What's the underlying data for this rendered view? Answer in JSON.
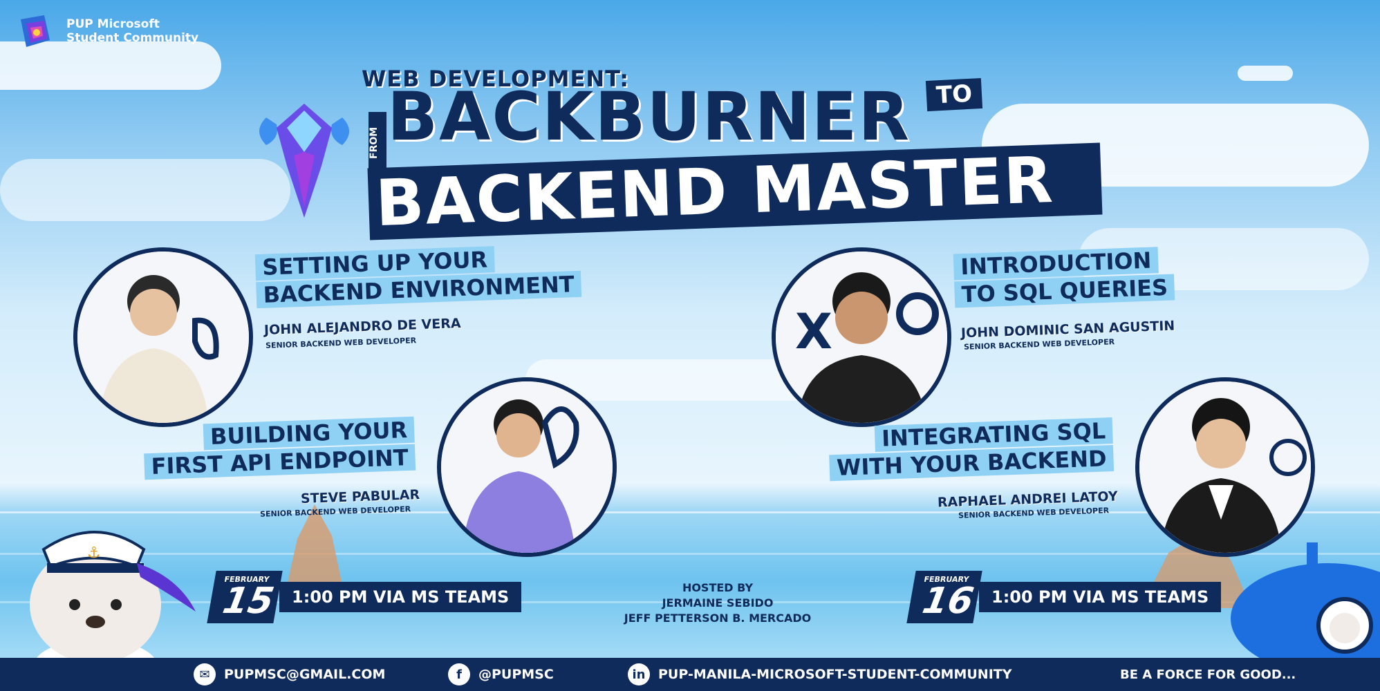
{
  "brand": {
    "name": "PUP Microsoft Student Community",
    "logo_icon": "pupmsc-logo-icon"
  },
  "title": {
    "kicker": "WEB DEVELOPMENT:",
    "from": "FROM",
    "line1": "BACKBURNER",
    "to": "TO",
    "line2": "BACKEND MASTER"
  },
  "sessions": [
    {
      "topic": [
        "SETTING UP YOUR",
        "BACKEND ENVIRONMENT"
      ],
      "speaker": "JOHN ALEJANDRO DE VERA",
      "role": "SENIOR BACKEND WEB DEVELOPER"
    },
    {
      "topic": [
        "BUILDING YOUR",
        "FIRST API ENDPOINT"
      ],
      "speaker": "STEVE PABULAR",
      "role": "SENIOR BACKEND WEB DEVELOPER"
    },
    {
      "topic": [
        "INTRODUCTION",
        "TO SQL QUERIES"
      ],
      "speaker": "JOHN DOMINIC SAN AGUSTIN",
      "role": "SENIOR BACKEND WEB DEVELOPER"
    },
    {
      "topic": [
        "INTEGRATING SQL",
        "WITH YOUR BACKEND"
      ],
      "speaker": "RAPHAEL ANDREI LATOY",
      "role": "SENIOR BACKEND WEB DEVELOPER"
    }
  ],
  "dates": [
    {
      "month": "FEBRUARY",
      "day": "15",
      "time": "1:00 PM VIA MS TEAMS"
    },
    {
      "month": "FEBRUARY",
      "day": "16",
      "time": "1:00 PM VIA MS TEAMS"
    }
  ],
  "hosted": {
    "label": "HOSTED BY",
    "hosts": [
      "JERMAINE SEBIDO",
      "JEFF PETTERSON B. MERCADO"
    ]
  },
  "footer": {
    "email": {
      "icon": "mail-icon",
      "text": "PUPMSC@GMAIL.COM"
    },
    "facebook": {
      "icon": "facebook-icon",
      "text": "@PUPMSC"
    },
    "linkedin": {
      "icon": "linkedin-icon",
      "text": "PUP-MANILA-MICROSOFT-STUDENT-COMMUNITY"
    },
    "tagline": "BE A FORCE FOR GOOD..."
  },
  "colors": {
    "navy": "#0f2b5b",
    "highlight": "#8fd0f5",
    "sky": "#4aa8e8"
  }
}
